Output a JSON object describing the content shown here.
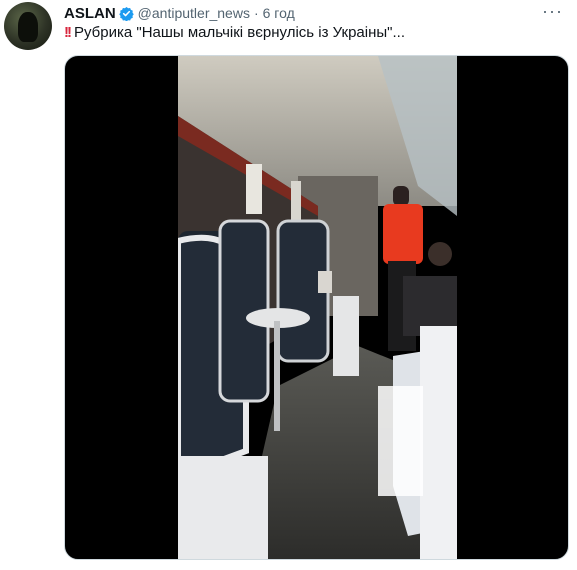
{
  "tweet": {
    "display_name": "ASLAN",
    "handle": "@antiputler_news",
    "separator": "·",
    "time": "6 год",
    "more_label": "···",
    "text": "Рубрика \"Нашы мальчікі вєрнулісь із Украіны\"...",
    "bang": "!!",
    "verified": true,
    "media": {
      "type": "video",
      "thumbnail": "train-dining-car-interior"
    }
  },
  "colors": {
    "accent": "#1d9bf0",
    "text": "#0f1419",
    "secondary": "#536471",
    "emoji_red": "#d7263d"
  }
}
